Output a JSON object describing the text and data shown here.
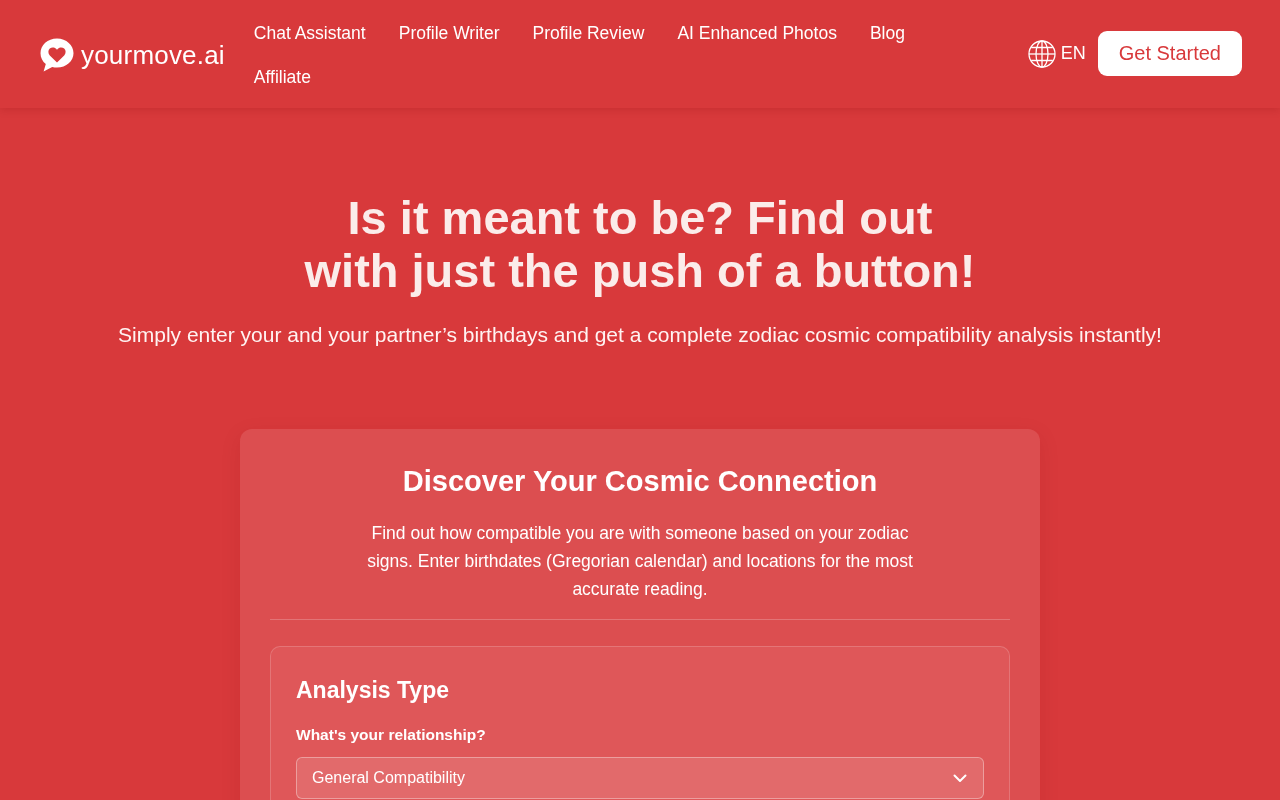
{
  "header": {
    "logo": "yourmove.ai",
    "nav": [
      "Chat Assistant",
      "Profile Writer",
      "Profile Review",
      "AI Enhanced Photos",
      "Blog",
      "Affiliate"
    ],
    "language": "EN",
    "cta": "Get Started"
  },
  "hero": {
    "title_lines": [
      "Is it meant to be? Find out",
      "with just the push of a button!"
    ],
    "subtitle": "Simply enter your and your partner’s birthdays and get a complete zodiac cosmic compatibility analysis instantly!"
  },
  "card": {
    "title": "Discover Your Cosmic Connection",
    "description": "Find out how compatible you are with someone based on your zodiac signs. Enter birthdates (Gregorian calendar) and locations for the most accurate reading.",
    "section": {
      "title": "Analysis Type",
      "field_label": "What's your relationship?",
      "select_value": "General Compatibility"
    }
  }
}
